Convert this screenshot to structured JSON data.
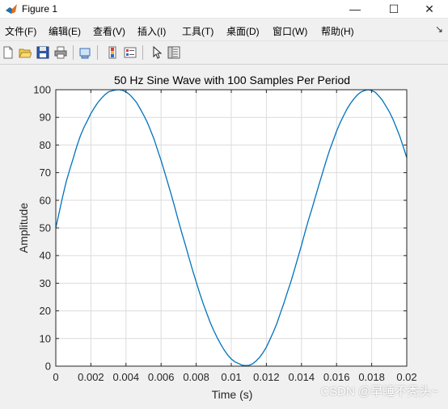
{
  "window": {
    "title": "Figure 1",
    "minimize_glyph": "—",
    "maximize_glyph": "☐",
    "close_glyph": "✕"
  },
  "menu": {
    "items": [
      {
        "label": "文件(F)"
      },
      {
        "label": "编辑(E)"
      },
      {
        "label": "查看(V)"
      },
      {
        "label": "插入(I)"
      },
      {
        "label": "工具(T)"
      },
      {
        "label": "桌面(D)"
      },
      {
        "label": "窗口(W)"
      },
      {
        "label": "帮助(H)"
      }
    ],
    "overflow_glyph": "↘"
  },
  "toolbar": {
    "buttons": [
      {
        "icon": "new-figure-icon"
      },
      {
        "icon": "open-file-icon"
      },
      {
        "icon": "save-icon"
      },
      {
        "icon": "print-icon"
      },
      {
        "icon": "link-plot-icon"
      },
      {
        "icon": "insert-colorbar-icon"
      },
      {
        "icon": "insert-legend-icon"
      },
      {
        "icon": "edit-plot-arrow-icon"
      },
      {
        "icon": "property-inspector-icon"
      }
    ]
  },
  "colors": {
    "line": "#0072bd",
    "grid": "#dcdcdc",
    "axis": "#262626",
    "figure_bg": "#f0f0f0"
  },
  "chart_data": {
    "type": "line",
    "title": "50 Hz Sine Wave with 100 Samples Per Period",
    "xlabel": "Time (s)",
    "ylabel": "Amplitude",
    "xlim": [
      0,
      0.02
    ],
    "ylim": [
      0,
      100
    ],
    "xticks": [
      "0",
      "0.002",
      "0.004",
      "0.006",
      "0.008",
      "0.01",
      "0.012",
      "0.014",
      "0.016",
      "0.018",
      "0.02"
    ],
    "yticks": [
      "0",
      "10",
      "20",
      "30",
      "40",
      "50",
      "60",
      "70",
      "80",
      "90",
      "100"
    ],
    "grid": true,
    "legend": "none",
    "series": [
      {
        "x": [
          0,
          0.0002,
          0.0004,
          0.0006,
          0.0008,
          0.001,
          0.0012,
          0.0014,
          0.0016,
          0.0018,
          0.002,
          0.0022,
          0.0024,
          0.0026,
          0.0028,
          0.003,
          0.0032,
          0.0034,
          0.0036,
          0.0038,
          0.004,
          0.0042,
          0.0044,
          0.0046,
          0.0048,
          0.005,
          0.0052,
          0.0054,
          0.0056,
          0.0058,
          0.006,
          0.0062,
          0.0064,
          0.0066,
          0.0068,
          0.007,
          0.0072,
          0.0074,
          0.0076,
          0.0078,
          0.008,
          0.0082,
          0.0084,
          0.0086,
          0.0088,
          0.009,
          0.0092,
          0.0094,
          0.0096,
          0.0098,
          0.01,
          0.0102,
          0.0104,
          0.0106,
          0.0108,
          0.011,
          0.0112,
          0.0114,
          0.0116,
          0.0118,
          0.012,
          0.0122,
          0.0124,
          0.0126,
          0.0128,
          0.013,
          0.0132,
          0.0134,
          0.0136,
          0.0138,
          0.014,
          0.0142,
          0.0144,
          0.0146,
          0.0148,
          0.015,
          0.0152,
          0.0154,
          0.0156,
          0.0158,
          0.016,
          0.0162,
          0.0164,
          0.0166,
          0.0168,
          0.017,
          0.0172,
          0.0174,
          0.0176,
          0.0178,
          0.018,
          0.0182,
          0.0184,
          0.0186,
          0.0188,
          0.019,
          0.0192,
          0.0194,
          0.0196,
          0.0198,
          0.02
        ],
        "y": [
          50,
          55.8,
          61.6,
          66.9,
          71.2,
          75.3,
          79.6,
          83.3,
          86.3,
          88.8,
          91.4,
          93.5,
          95.4,
          96.9,
          98.2,
          99.2,
          99.6,
          99.9,
          100,
          99.8,
          99.2,
          98.3,
          96.9,
          95.4,
          93.2,
          90.9,
          88.4,
          85.3,
          82.1,
          78.2,
          74.4,
          70.2,
          65.9,
          61.6,
          57.0,
          52.3,
          47.8,
          43.5,
          39.0,
          34.6,
          30.5,
          26.4,
          22.6,
          19.2,
          15.8,
          12.9,
          10.3,
          7.9,
          5.8,
          4.0,
          2.6,
          1.6,
          1.0,
          0.4,
          0.2,
          0.3,
          0.8,
          1.8,
          3.1,
          4.8,
          6.9,
          9.6,
          12.4,
          15.5,
          19.2,
          22.8,
          26.8,
          30.6,
          34.9,
          39.3,
          43.7,
          48.4,
          52.9,
          57.0,
          61.4,
          65.7,
          69.9,
          74.1,
          78.1,
          81.5,
          85.0,
          88.0,
          90.6,
          93.1,
          95.1,
          96.8,
          98.2,
          99.2,
          99.7,
          100,
          99.7,
          99.1,
          97.8,
          96.3,
          94.2,
          92.1,
          89.5,
          86.4,
          83.2,
          79.4,
          75.4
        ]
      }
    ]
  },
  "watermark": "CSDN @早睡不秃头~"
}
